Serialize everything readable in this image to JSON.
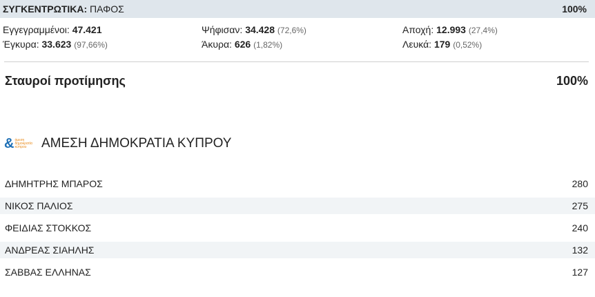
{
  "summary": {
    "label": "ΣΥΓΚΕΝΤΡΩΤΙΚΑ:",
    "region": "ΠΑΦΟΣ",
    "percent": "100%"
  },
  "stats": {
    "registered": {
      "label": "Εγγεγραμμένοι:",
      "value": "47.421",
      "sub": ""
    },
    "voted": {
      "label": "Ψήφισαν:",
      "value": "34.428",
      "sub": "(72,6%)"
    },
    "abstention": {
      "label": "Αποχή:",
      "value": "12.993",
      "sub": "(27,4%)"
    },
    "valid": {
      "label": "Έγκυρα:",
      "value": "33.623",
      "sub": "(97,66%)"
    },
    "invalid": {
      "label": "Άκυρα:",
      "value": "626",
      "sub": "(1,82%)"
    },
    "blank": {
      "label": "Λευκά:",
      "value": "179",
      "sub": "(0,52%)"
    }
  },
  "section": {
    "title": "Σταυροί προτίμησης",
    "percent": "100%"
  },
  "party": {
    "name": "ΑΜΕΣΗ ΔΗΜΟΚΡΑΤΙΑ ΚΥΠΡΟΥ",
    "logo_icon": "ampersand-logo-icon",
    "logo_text": [
      "άμεση",
      "δημοκρατία",
      "κύπρου"
    ],
    "colors": {
      "blue": "#1d6fb5",
      "orange": "#e88a1a"
    }
  },
  "candidates": [
    {
      "name": "ΔΗΜΗΤΡΗΣ ΜΠΑΡΟΣ",
      "votes": "280"
    },
    {
      "name": "ΝΙΚΟΣ ΠΑΛΙΟΣ",
      "votes": "275"
    },
    {
      "name": "ΦΕΙΔΙΑΣ ΣΤΟΚΚΟΣ",
      "votes": "240"
    },
    {
      "name": "ΑΝΔΡΕΑΣ ΣΙΑΗΛΗΣ",
      "votes": "132"
    },
    {
      "name": "ΣΑΒΒΑΣ ΕΛΛΗΝΑΣ",
      "votes": "127"
    }
  ]
}
